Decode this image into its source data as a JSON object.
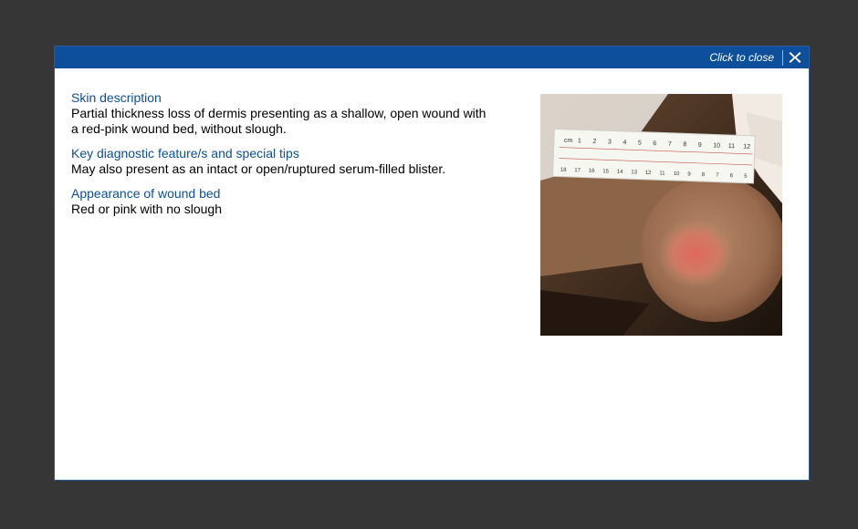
{
  "header": {
    "close_label": "Click to close",
    "close_icon": "close-x-icon"
  },
  "sections": [
    {
      "title": "Skin description",
      "body": "Partial thickness loss of dermis presenting as a shallow, open wound with a red-pink wound bed, without slough."
    },
    {
      "title": "Key diagnostic feature/s and special tips",
      "body": "May also present as an intact or open/ruptured serum-filled blister."
    },
    {
      "title": "Appearance of wound bed",
      "body": "Red or pink with no slough"
    }
  ],
  "photo": {
    "ruler_unit": "cm",
    "ruler_top_numbers": [
      "1",
      "2",
      "3",
      "4",
      "5",
      "6",
      "7",
      "8",
      "9",
      "10",
      "11",
      "12"
    ],
    "ruler_bottom_numbers": [
      "18",
      "17",
      "16",
      "15",
      "14",
      "13",
      "12",
      "11",
      "10",
      "9",
      "8",
      "7",
      "6",
      "5"
    ]
  },
  "colors": {
    "header": "#0d4f9a",
    "title": "#0d4f9a",
    "backdrop": "#363636"
  }
}
